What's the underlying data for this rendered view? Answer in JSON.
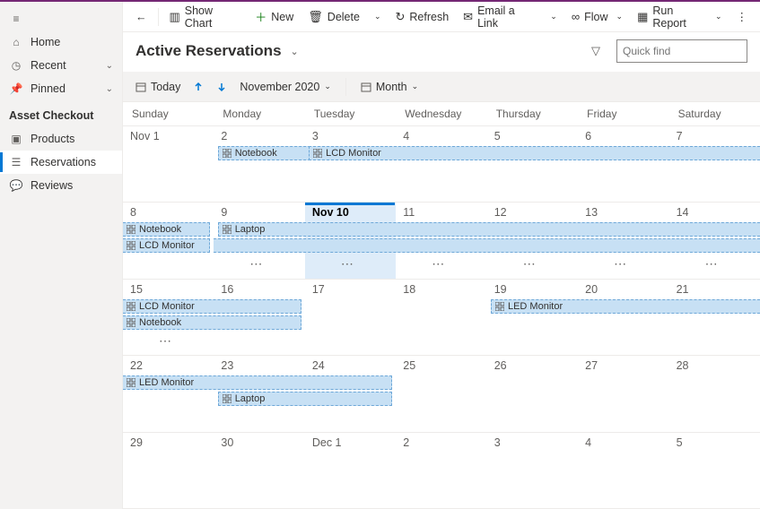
{
  "sidebar": {
    "nav": [
      {
        "icon": "hamburger",
        "label": ""
      },
      {
        "icon": "home",
        "label": "Home"
      },
      {
        "icon": "clock",
        "label": "Recent",
        "chev": true
      },
      {
        "icon": "pin",
        "label": "Pinned",
        "chev": true
      }
    ],
    "section_title": "Asset Checkout",
    "items": [
      {
        "icon": "cube",
        "label": "Products"
      },
      {
        "icon": "list",
        "label": "Reservations",
        "active": true
      },
      {
        "icon": "chat",
        "label": "Reviews"
      }
    ]
  },
  "commands": {
    "back": "←",
    "show_chart": "Show Chart",
    "new": "New",
    "delete": "Delete",
    "refresh": "Refresh",
    "email": "Email a Link",
    "flow": "Flow",
    "run_report": "Run Report"
  },
  "header": {
    "title": "Active Reservations"
  },
  "search": {
    "placeholder": "Quick find"
  },
  "calendar_bar": {
    "today": "Today",
    "month_year": "November 2020",
    "view": "Month"
  },
  "day_headers": [
    "Sunday",
    "Monday",
    "Tuesday",
    "Wednesday",
    "Thursday",
    "Friday",
    "Saturday"
  ],
  "weeks": [
    {
      "days": [
        "Nov 1",
        "2",
        "3",
        "4",
        "5",
        "6",
        "7"
      ],
      "events": [
        {
          "label": "Notebook",
          "start": 1,
          "span": 6,
          "open_start": false,
          "open_end": true
        },
        {
          "label": "LCD Monitor",
          "start": 2,
          "span": 5,
          "open_start": false,
          "open_end": true
        }
      ]
    },
    {
      "days": [
        "8",
        "9",
        "Nov 10",
        "11",
        "12",
        "13",
        "14"
      ],
      "today_col": 2,
      "events": [
        {
          "label": "Notebook",
          "start": 0,
          "span": 1,
          "open_start": true,
          "open_end": false
        },
        {
          "label": "Laptop",
          "start": 1,
          "span": 6,
          "open_start": false,
          "open_end": true,
          "row": 0
        },
        {
          "label": "LCD Monitor",
          "start": 0,
          "span": 1,
          "open_start": true,
          "open_end": false,
          "row": 1
        },
        {
          "label": "",
          "start": 1,
          "span": 6,
          "open_start": true,
          "open_end": true,
          "row": 1,
          "nolabel": true
        }
      ],
      "more_cols": [
        1,
        2,
        3,
        4,
        5,
        6
      ]
    },
    {
      "days": [
        "15",
        "16",
        "17",
        "18",
        "19",
        "20",
        "21"
      ],
      "events": [
        {
          "label": "LCD Monitor",
          "start": 0,
          "span": 2,
          "open_start": true,
          "open_end": false
        },
        {
          "label": "LED Monitor",
          "start": 4,
          "span": 3,
          "open_start": false,
          "open_end": true,
          "row": 0
        },
        {
          "label": "Notebook",
          "start": 0,
          "span": 2,
          "open_start": true,
          "open_end": false,
          "row": 1
        }
      ],
      "more_cols": [
        0
      ]
    },
    {
      "days": [
        "22",
        "23",
        "24",
        "25",
        "26",
        "27",
        "28"
      ],
      "events": [
        {
          "label": "LED Monitor",
          "start": 0,
          "span": 3,
          "open_start": true,
          "open_end": false
        },
        {
          "label": "Laptop",
          "start": 1,
          "span": 2,
          "open_start": false,
          "open_end": false,
          "row": 1
        }
      ]
    },
    {
      "days": [
        "29",
        "30",
        "Dec 1",
        "2",
        "3",
        "4",
        "5"
      ],
      "events": []
    }
  ],
  "more_label": "⋯"
}
